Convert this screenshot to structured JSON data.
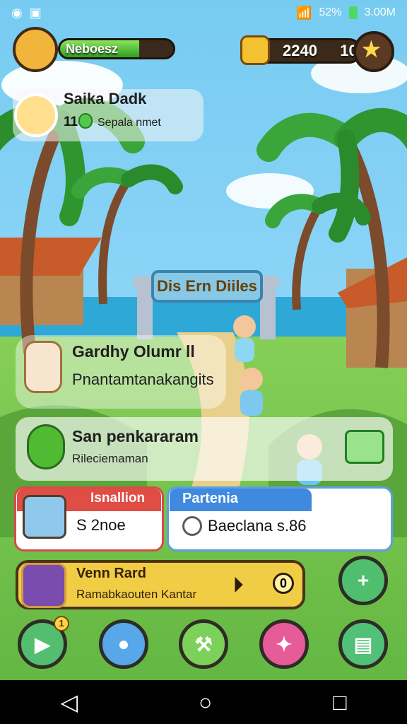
{
  "status": {
    "left_icons": [
      "app-icon",
      "image-icon"
    ],
    "right_text": "52%",
    "time": "3.00M"
  },
  "hud": {
    "progress_label": "Neboesz",
    "coins": "2240",
    "gems": "10"
  },
  "player": {
    "name": "Saika Dadk",
    "level": "11",
    "status": "Sepala nmet"
  },
  "gate": {
    "title": "Dis Ern Diiles"
  },
  "quest": {
    "title": "Gardhy Olumr  ll",
    "subtitle": "Pnantamtanakangits"
  },
  "event": {
    "title": "San penkararam",
    "subtitle": "Rileciemaman"
  },
  "panels": {
    "red": {
      "title": "Isnallion",
      "text": "S  2noe"
    },
    "blue": {
      "title": "Partenia",
      "text": "Baeclana  s.86"
    }
  },
  "menu": {
    "title": "Venn Rard",
    "subtitle": "Ramabkaouten Kantar",
    "action_b": "0"
  },
  "buttons": {
    "badge": "1"
  },
  "colors": {
    "sky": "#78cdf1",
    "grass": "#74c64a",
    "accent_yellow": "#f1cd45",
    "accent_red": "#df4d45",
    "accent_blue": "#3f89de"
  }
}
